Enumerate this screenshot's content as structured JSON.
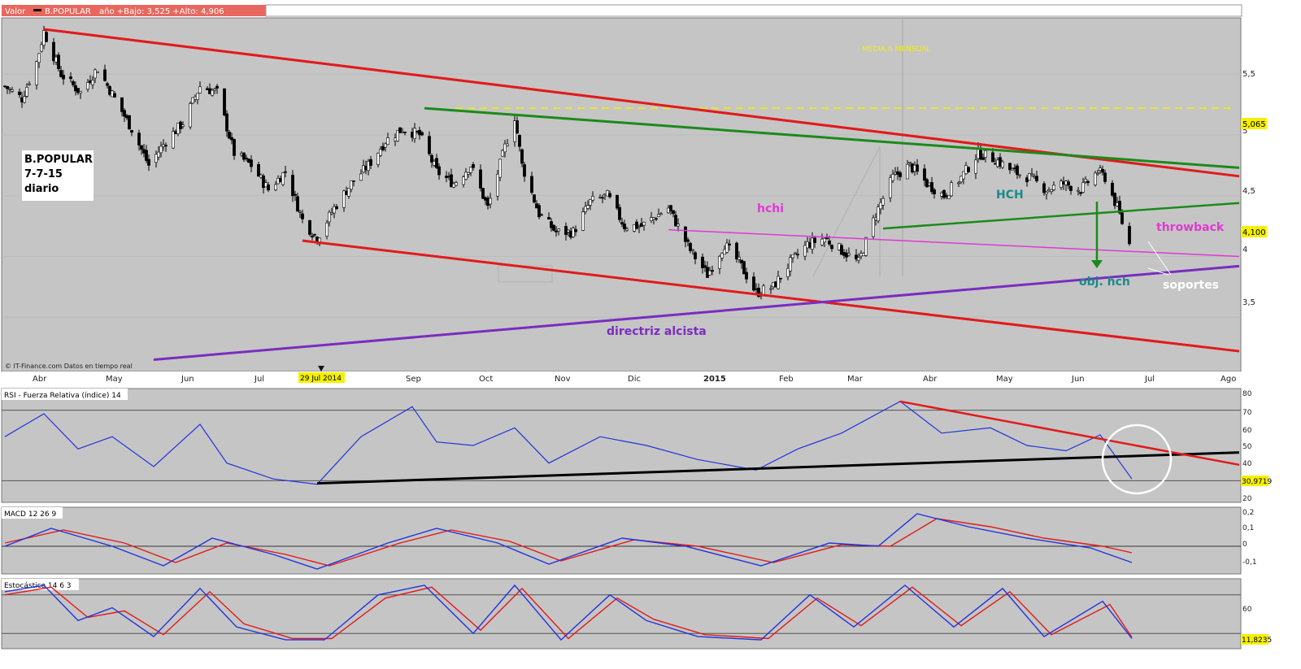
{
  "header": {
    "label": "Valor",
    "symbol": "B.POPULAR",
    "range_text": "año +Bajo: 3,525 +Alto: 4,906"
  },
  "info_box": {
    "line1": "B.POPULAR",
    "line2": "7-7-15",
    "line3": "diario"
  },
  "colors": {
    "panel_bg": "#c5c5c5",
    "candle_up": "#ffffff",
    "candle_down": "#000000",
    "resistance_red": "#e21a1a",
    "green_line": "#1b8a1b",
    "purple_line": "#7b2cc0",
    "magenta_line": "#e03ad2",
    "rsi_blue": "#2233dd",
    "macd_red": "#e21a1a",
    "label_yellow": "#f5f000",
    "header_bar": "#e8685f"
  },
  "annotations": {
    "media": "MEDIA 6   MENSUAL",
    "hchi": "hchi",
    "hch": "HCH",
    "throwback": "throwback",
    "obj_hch": "obj. hch",
    "soportes": "soportes",
    "directriz": "directriz alcista",
    "source": "© IT-Finance.com  Datos en tiempo real"
  },
  "price_axis": {
    "ticks": [
      "5,5",
      "5",
      "4,5",
      "4",
      "3,5"
    ],
    "label_top": "5,065",
    "label_last": "4,100"
  },
  "x_axis": {
    "months": [
      "Abr",
      "May",
      "Jun",
      "Jul",
      "Sep",
      "Oct",
      "Nov",
      "Dic",
      "2015",
      "Feb",
      "Mar",
      "Abr",
      "May",
      "Jun",
      "Jul",
      "Ago"
    ],
    "marker_label": "29 Jul 2014"
  },
  "rsi": {
    "title": "RSI - Fuerza Relativa (índice) 14",
    "ticks": [
      "80",
      "70",
      "60",
      "50",
      "40",
      "30",
      "20"
    ],
    "last_label": "30,9719"
  },
  "macd": {
    "title": "MACD 12 26 9",
    "ticks": [
      "0,2",
      "0,1",
      "0",
      "-0,1"
    ]
  },
  "stoch": {
    "title": "Estocástico 14 6 3",
    "ticks": [
      "60"
    ],
    "last_label": "11,8235"
  },
  "chart_data": {
    "type": "line",
    "title": "B.POPULAR",
    "subtitle": "7-7-15 diario",
    "x_range": [
      "2014-04-01",
      "2015-08-20"
    ],
    "ylim": [
      3.1,
      5.95
    ],
    "price_series": {
      "name": "B.POPULAR",
      "points": [
        [
          "2014-04-01",
          5.4
        ],
        [
          "2014-04-08",
          5.3
        ],
        [
          "2014-04-14",
          5.6
        ],
        [
          "2014-04-17",
          5.85
        ],
        [
          "2014-04-24",
          5.5
        ],
        [
          "2014-05-02",
          5.35
        ],
        [
          "2014-05-09",
          5.55
        ],
        [
          "2014-05-16",
          5.3
        ],
        [
          "2014-05-23",
          5.05
        ],
        [
          "2014-05-30",
          4.75
        ],
        [
          "2014-06-06",
          4.95
        ],
        [
          "2014-06-13",
          5.1
        ],
        [
          "2014-06-20",
          5.4
        ],
        [
          "2014-06-27",
          5.35
        ],
        [
          "2014-07-04",
          4.85
        ],
        [
          "2014-07-11",
          4.75
        ],
        [
          "2014-07-18",
          4.55
        ],
        [
          "2014-07-25",
          4.7
        ],
        [
          "2014-08-01",
          4.3
        ],
        [
          "2014-08-07",
          4.15
        ],
        [
          "2014-08-14",
          4.4
        ],
        [
          "2014-08-21",
          4.6
        ],
        [
          "2014-08-28",
          4.75
        ],
        [
          "2014-09-04",
          4.95
        ],
        [
          "2014-09-11",
          5.05
        ],
        [
          "2014-09-18",
          5.0
        ],
        [
          "2014-09-25",
          4.7
        ],
        [
          "2014-10-02",
          4.6
        ],
        [
          "2014-10-09",
          4.75
        ],
        [
          "2014-10-16",
          4.4
        ],
        [
          "2014-10-23",
          4.9
        ],
        [
          "2014-10-27",
          5.15
        ],
        [
          "2014-10-30",
          4.75
        ],
        [
          "2014-11-06",
          4.35
        ],
        [
          "2014-11-13",
          4.2
        ],
        [
          "2014-11-20",
          4.2
        ],
        [
          "2014-11-27",
          4.45
        ],
        [
          "2014-12-04",
          4.5
        ],
        [
          "2014-12-11",
          4.25
        ],
        [
          "2014-12-18",
          4.25
        ],
        [
          "2014-12-29",
          4.4
        ],
        [
          "2015-01-07",
          4.05
        ],
        [
          "2015-01-14",
          3.85
        ],
        [
          "2015-01-21",
          4.1
        ],
        [
          "2015-01-27",
          3.95
        ],
        [
          "2015-02-03",
          3.7
        ],
        [
          "2015-02-10",
          3.75
        ],
        [
          "2015-02-17",
          3.95
        ],
        [
          "2015-02-24",
          4.1
        ],
        [
          "2015-03-03",
          4.15
        ],
        [
          "2015-03-10",
          4.05
        ],
        [
          "2015-03-17",
          3.95
        ],
        [
          "2015-03-24",
          4.35
        ],
        [
          "2015-03-31",
          4.65
        ],
        [
          "2015-04-07",
          4.75
        ],
        [
          "2015-04-14",
          4.6
        ],
        [
          "2015-04-21",
          4.5
        ],
        [
          "2015-04-28",
          4.65
        ],
        [
          "2015-05-05",
          4.85
        ],
        [
          "2015-05-12",
          4.8
        ],
        [
          "2015-05-19",
          4.7
        ],
        [
          "2015-05-26",
          4.65
        ],
        [
          "2015-06-02",
          4.55
        ],
        [
          "2015-06-09",
          4.6
        ],
        [
          "2015-06-16",
          4.55
        ],
        [
          "2015-06-23",
          4.7
        ],
        [
          "2015-06-26",
          4.65
        ],
        [
          "2015-07-01",
          4.4
        ],
        [
          "2015-07-06",
          4.1
        ]
      ]
    },
    "trendlines": [
      {
        "name": "resistance",
        "from": [
          "2014-04-17",
          5.87
        ],
        "to": [
          "2015-08-20",
          4.66
        ]
      },
      {
        "name": "support channel",
        "from": [
          "2014-08-01",
          4.13
        ],
        "to": [
          "2015-08-20",
          3.22
        ]
      },
      {
        "name": "directriz alcista",
        "from": [
          "2014-06-01",
          3.15
        ],
        "to": [
          "2015-08-20",
          3.92
        ]
      },
      {
        "name": "upper green",
        "from": [
          "2014-09-20",
          5.22
        ],
        "to": [
          "2015-08-20",
          4.73
        ]
      },
      {
        "name": "HCH neckline",
        "from": [
          "2015-03-27",
          4.23
        ],
        "to": [
          "2015-08-20",
          4.44
        ]
      },
      {
        "name": "hchi",
        "from": [
          "2014-12-29",
          4.22
        ],
        "to": [
          "2015-08-20",
          4.0
        ]
      }
    ],
    "rsi_series": {
      "ylim": [
        20,
        80
      ],
      "points": [
        [
          "2014-04-01",
          55
        ],
        [
          "2014-04-17",
          68
        ],
        [
          "2014-05-01",
          48
        ],
        [
          "2014-05-15",
          55
        ],
        [
          "2014-06-01",
          38
        ],
        [
          "2014-06-20",
          62
        ],
        [
          "2014-07-01",
          40
        ],
        [
          "2014-07-20",
          31
        ],
        [
          "2014-08-07",
          28
        ],
        [
          "2014-08-25",
          55
        ],
        [
          "2014-09-15",
          72
        ],
        [
          "2014-09-25",
          52
        ],
        [
          "2014-10-10",
          50
        ],
        [
          "2014-10-27",
          60
        ],
        [
          "2014-11-10",
          40
        ],
        [
          "2014-12-01",
          55
        ],
        [
          "2014-12-20",
          50
        ],
        [
          "2015-01-10",
          42
        ],
        [
          "2015-02-03",
          36
        ],
        [
          "2015-02-20",
          48
        ],
        [
          "2015-03-10",
          57
        ],
        [
          "2015-04-03",
          75
        ],
        [
          "2015-04-20",
          57
        ],
        [
          "2015-05-10",
          60
        ],
        [
          "2015-05-25",
          50
        ],
        [
          "2015-06-10",
          47
        ],
        [
          "2015-06-24",
          56
        ],
        [
          "2015-07-07",
          31
        ]
      ],
      "trendlines": [
        {
          "from": [
            "2014-08-07",
            28.5
          ],
          "to": [
            "2015-08-20",
            46
          ]
        },
        {
          "from": [
            "2015-04-03",
            75
          ],
          "to": [
            "2015-08-20",
            39
          ]
        }
      ]
    },
    "macd_series": {
      "ylim": [
        -0.15,
        0.22
      ],
      "macd": [
        [
          "2014-04-01",
          0.0
        ],
        [
          "2014-04-20",
          0.11
        ],
        [
          "2014-05-15",
          0.0
        ],
        [
          "2014-06-05",
          -0.12
        ],
        [
          "2014-06-25",
          0.05
        ],
        [
          "2014-07-20",
          -0.05
        ],
        [
          "2014-08-07",
          -0.14
        ],
        [
          "2014-09-05",
          0.02
        ],
        [
          "2014-09-25",
          0.11
        ],
        [
          "2014-10-20",
          0.02
        ],
        [
          "2014-11-10",
          -0.11
        ],
        [
          "2014-12-10",
          0.05
        ],
        [
          "2015-01-05",
          0.0
        ],
        [
          "2015-02-05",
          -0.12
        ],
        [
          "2015-03-05",
          0.02
        ],
        [
          "2015-03-25",
          0.0
        ],
        [
          "2015-04-10",
          0.2
        ],
        [
          "2015-05-01",
          0.12
        ],
        [
          "2015-05-25",
          0.05
        ],
        [
          "2015-06-20",
          -0.01
        ],
        [
          "2015-07-07",
          -0.1
        ]
      ],
      "signal": [
        [
          "2014-04-01",
          0.02
        ],
        [
          "2014-04-25",
          0.1
        ],
        [
          "2014-05-20",
          0.02
        ],
        [
          "2014-06-10",
          -0.1
        ],
        [
          "2014-07-01",
          0.02
        ],
        [
          "2014-07-25",
          -0.05
        ],
        [
          "2014-08-12",
          -0.12
        ],
        [
          "2014-09-10",
          0.02
        ],
        [
          "2014-10-01",
          0.1
        ],
        [
          "2014-10-25",
          0.03
        ],
        [
          "2014-11-15",
          -0.09
        ],
        [
          "2014-12-15",
          0.04
        ],
        [
          "2015-01-10",
          0.0
        ],
        [
          "2015-02-10",
          -0.1
        ],
        [
          "2015-03-10",
          0.01
        ],
        [
          "2015-03-30",
          0.0
        ],
        [
          "2015-04-18",
          0.17
        ],
        [
          "2015-05-10",
          0.12
        ],
        [
          "2015-06-01",
          0.05
        ],
        [
          "2015-06-25",
          0.0
        ],
        [
          "2015-07-07",
          -0.04
        ]
      ]
    },
    "stoch_series": {
      "ylim": [
        0,
        100
      ],
      "k": [
        [
          "2014-04-01",
          85
        ],
        [
          "2014-04-17",
          95
        ],
        [
          "2014-05-01",
          40
        ],
        [
          "2014-05-15",
          60
        ],
        [
          "2014-06-01",
          15
        ],
        [
          "2014-06-20",
          90
        ],
        [
          "2014-07-05",
          30
        ],
        [
          "2014-07-25",
          10
        ],
        [
          "2014-08-10",
          10
        ],
        [
          "2014-09-01",
          80
        ],
        [
          "2014-09-20",
          95
        ],
        [
          "2014-10-10",
          20
        ],
        [
          "2014-10-27",
          95
        ],
        [
          "2014-11-15",
          10
        ],
        [
          "2014-12-05",
          80
        ],
        [
          "2014-12-20",
          40
        ],
        [
          "2015-01-10",
          15
        ],
        [
          "2015-02-05",
          10
        ],
        [
          "2015-02-25",
          80
        ],
        [
          "2015-03-15",
          30
        ],
        [
          "2015-04-05",
          95
        ],
        [
          "2015-04-25",
          30
        ],
        [
          "2015-05-15",
          90
        ],
        [
          "2015-06-01",
          15
        ],
        [
          "2015-06-25",
          70
        ],
        [
          "2015-07-07",
          12
        ]
      ],
      "d": [
        [
          "2014-04-01",
          80
        ],
        [
          "2014-04-20",
          92
        ],
        [
          "2014-05-05",
          45
        ],
        [
          "2014-05-20",
          55
        ],
        [
          "2014-06-05",
          18
        ],
        [
          "2014-06-24",
          85
        ],
        [
          "2014-07-08",
          35
        ],
        [
          "2014-07-28",
          12
        ],
        [
          "2014-08-13",
          12
        ],
        [
          "2014-09-04",
          75
        ],
        [
          "2014-09-23",
          92
        ],
        [
          "2014-10-13",
          25
        ],
        [
          "2014-10-30",
          90
        ],
        [
          "2014-11-18",
          12
        ],
        [
          "2014-12-08",
          75
        ],
        [
          "2014-12-23",
          42
        ],
        [
          "2015-01-13",
          18
        ],
        [
          "2015-02-08",
          12
        ],
        [
          "2015-02-28",
          75
        ],
        [
          "2015-03-18",
          32
        ],
        [
          "2015-04-08",
          92
        ],
        [
          "2015-04-28",
          32
        ],
        [
          "2015-05-18",
          85
        ],
        [
          "2015-06-04",
          18
        ],
        [
          "2015-06-28",
          65
        ],
        [
          "2015-07-07",
          14
        ]
      ]
    }
  }
}
